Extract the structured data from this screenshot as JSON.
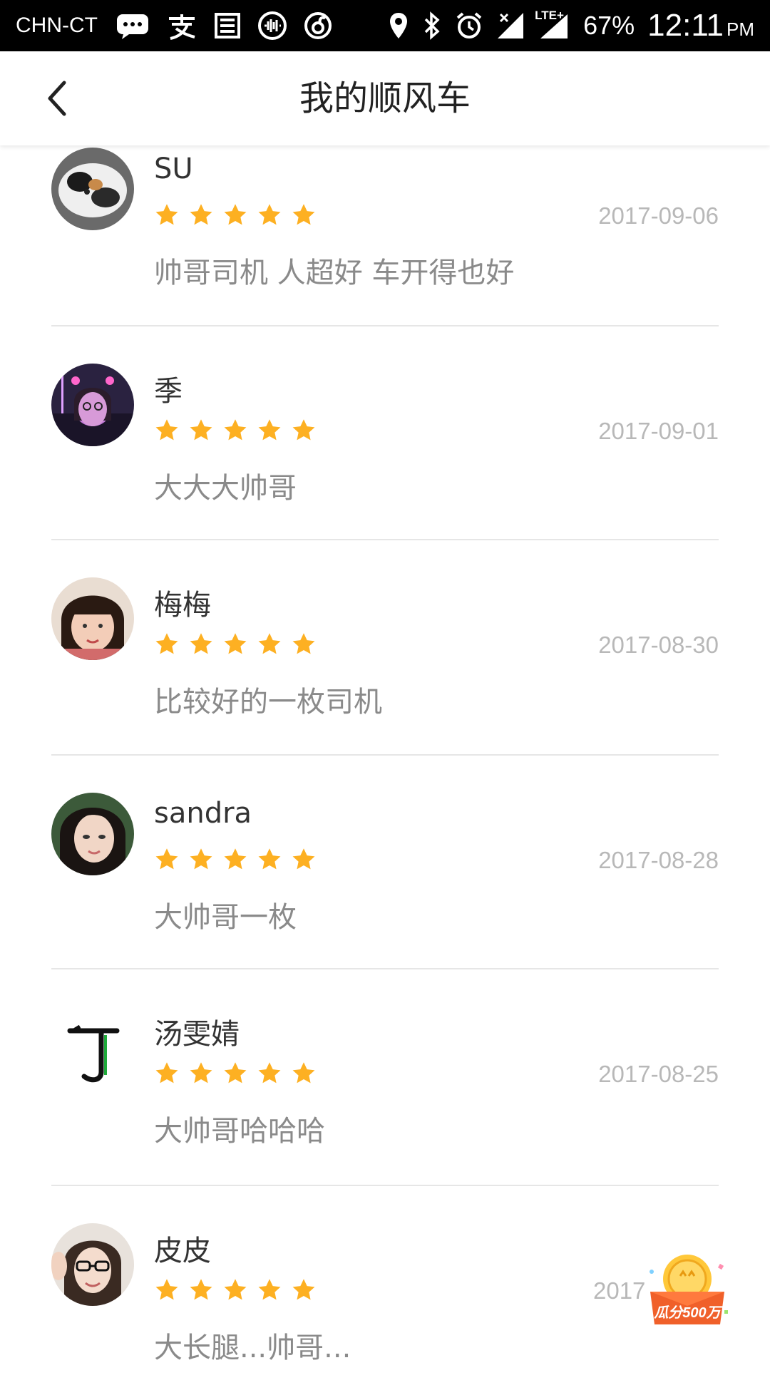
{
  "status_bar": {
    "carrier": "CHN-CT",
    "network": "LTE+",
    "battery": "67%",
    "time": "12:11",
    "ampm": "PM"
  },
  "header": {
    "title": "我的顺风车"
  },
  "reviews": [
    {
      "name": "SU",
      "rating": 5,
      "date": "2017-09-06",
      "comment": "帅哥司机 人超好 车开得也好"
    },
    {
      "name": "季",
      "rating": 5,
      "date": "2017-09-01",
      "comment": "大大大帅哥"
    },
    {
      "name": "梅梅",
      "rating": 5,
      "date": "2017-08-30",
      "comment": "比较好的一枚司机"
    },
    {
      "name": "sandra",
      "rating": 5,
      "date": "2017-08-28",
      "comment": "大帅哥一枚"
    },
    {
      "name": "汤雯婧",
      "rating": 5,
      "date": "2017-08-25",
      "comment": "大帅哥哈哈哈"
    },
    {
      "name": "皮皮",
      "rating": 5,
      "date": "2017",
      "comment": "大长腿...帅哥..."
    }
  ],
  "promo": {
    "label": "瓜分500万"
  },
  "colors": {
    "star": "#FDB022",
    "date": "#B8B8B8",
    "comment": "#8A8A8A",
    "divider": "#E6E6E6"
  },
  "avatar_initial": {
    "tang": "了"
  }
}
